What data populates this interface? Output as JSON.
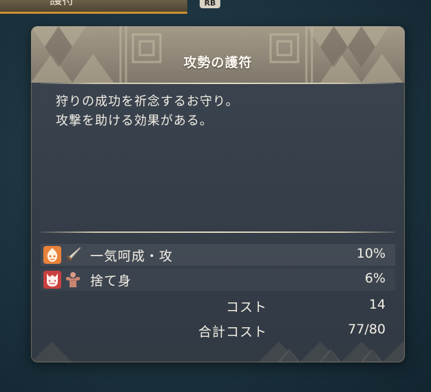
{
  "top_tab": {
    "label": "護符",
    "badge": "RB"
  },
  "panel": {
    "title": "攻勢の護符",
    "description": [
      "狩りの成功を祈念するお守り。",
      "攻撃を助ける効果がある。"
    ],
    "skills": [
      {
        "name": "一気呵成・攻",
        "value": "10%",
        "badge_icon": "flame-face-icon",
        "type_icon": "sword-icon",
        "badge_color": "#e8823a"
      },
      {
        "name": "捨て身",
        "value": "6%",
        "badge_icon": "demon-face-icon",
        "type_icon": "muscle-body-icon",
        "badge_color": "#c94040"
      }
    ],
    "cost": {
      "label": "コスト",
      "value": "14"
    },
    "total_cost": {
      "label": "合計コスト",
      "value": "77/80"
    }
  },
  "colors": {
    "tab_accent": "#d0902e",
    "panel_bg": "#3a434e",
    "header_bg": "#8e8677"
  }
}
